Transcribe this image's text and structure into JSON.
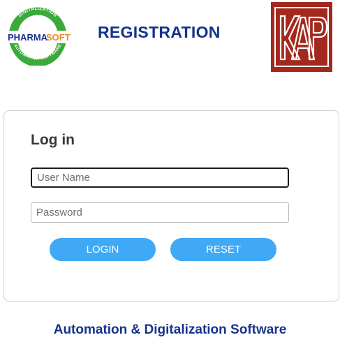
{
  "header": {
    "title": "REGISTRATION",
    "left_logo": {
      "icon": "pharmasoft-logo",
      "top_text": "DIGITALIZATION",
      "brand_first": "PHARMA",
      "brand_second": "SOFT",
      "bottom_text": "AUTOMATION SOFTWARE"
    },
    "right_logo": {
      "icon": "kap-logo",
      "text": "KAP"
    }
  },
  "login": {
    "title": "Log in",
    "username_placeholder": "User Name",
    "username_value": "",
    "password_placeholder": "Password",
    "password_value": "",
    "login_label": "LOGIN",
    "reset_label": "RESET"
  },
  "footer": {
    "tagline": "Automation & Digitalization Software"
  },
  "colors": {
    "title_blue": "#16338c",
    "button_blue": "#3fa9f5",
    "kap_red": "#a3281d",
    "pharmasoft_green": "#3aaa3a",
    "pharmasoft_orange": "#f08a1c"
  }
}
